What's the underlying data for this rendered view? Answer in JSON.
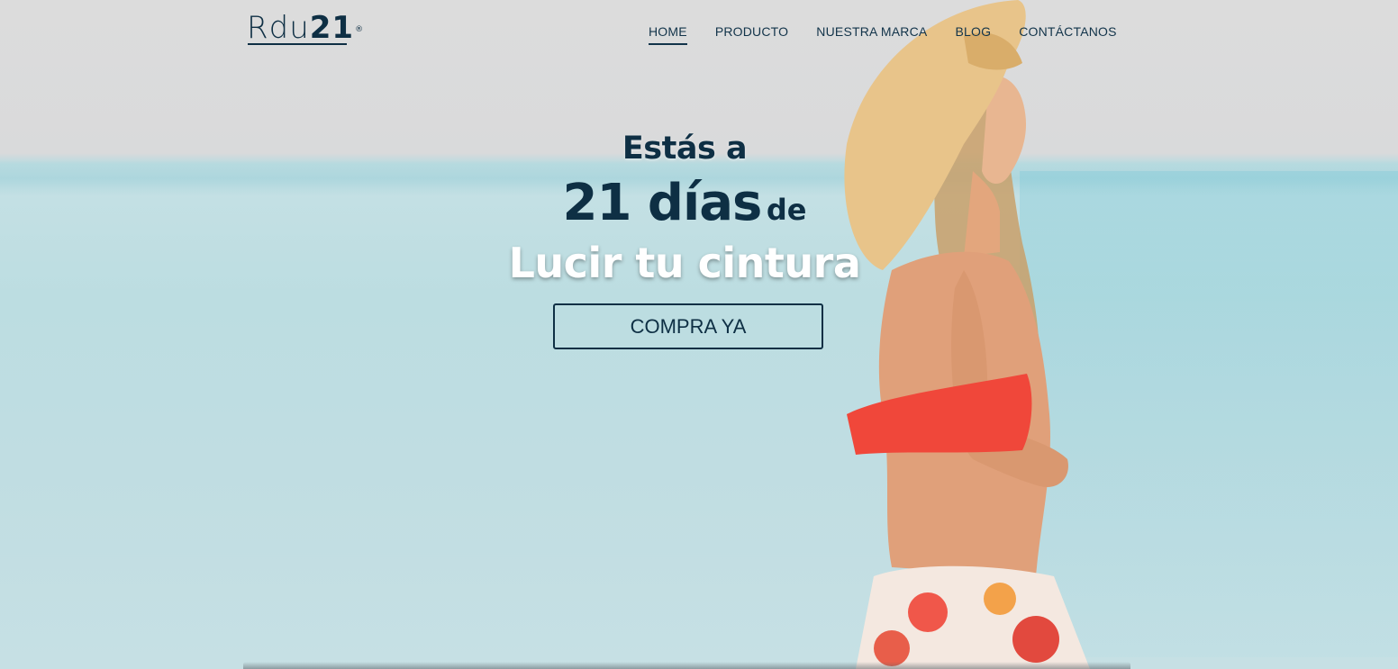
{
  "brand": {
    "logo_light": "Rdu",
    "logo_bold": "21",
    "logo_mark": "®"
  },
  "nav": {
    "items": [
      {
        "label": "HOME",
        "active": true
      },
      {
        "label": "PRODUCTO",
        "active": false
      },
      {
        "label": "NUESTRA MARCA",
        "active": false
      },
      {
        "label": "BLOG",
        "active": false
      },
      {
        "label": "CONTÁCTANOS",
        "active": false
      }
    ]
  },
  "hero": {
    "line1": "Estás a",
    "line2_big": "21 días",
    "line2_small": "de",
    "line3": "Lucir tu cintura",
    "cta_label": "COMPRA YA"
  },
  "colors": {
    "brand": "#0e2f44",
    "bikini": "#f0473a",
    "hat": "#e8c48a",
    "sky": "#dcdcdc",
    "sea": "#bcdde1"
  }
}
